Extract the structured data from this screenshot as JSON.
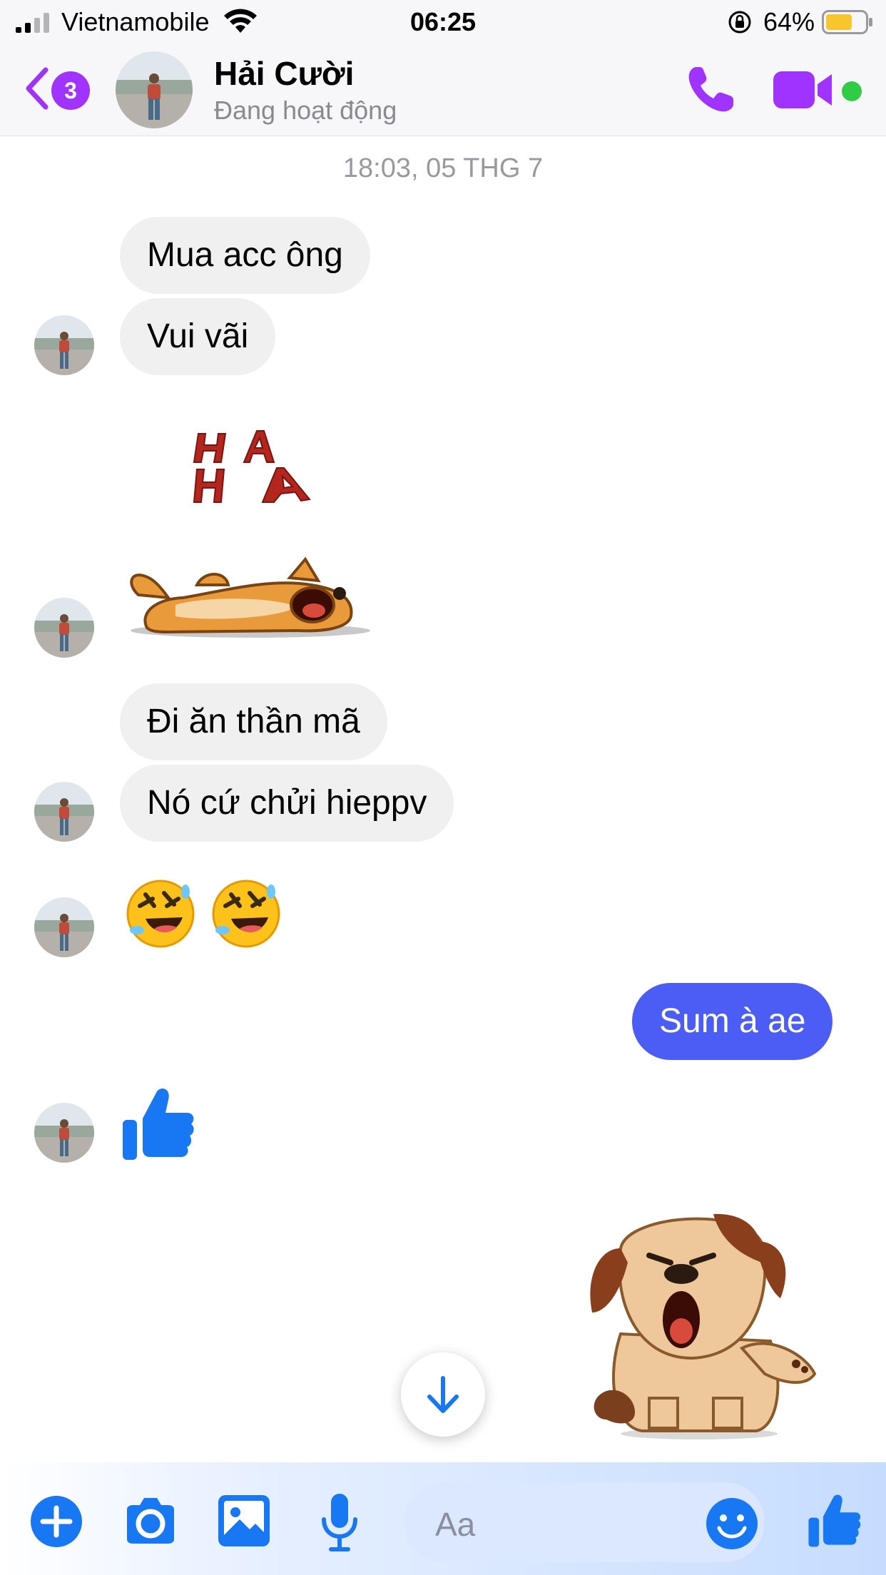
{
  "status_bar": {
    "carrier": "Vietnamobile",
    "time": "06:25",
    "battery": "64%"
  },
  "header": {
    "back_badge": "3",
    "contact_name": "Hải Cười",
    "contact_status": "Đang hoạt động"
  },
  "conversation": {
    "timestamp": "18:03, 05 THG 7",
    "messages_in": [
      "Mua acc ông",
      "Vui vãi",
      "Đi ăn thần mã",
      "Nó cứ chửi hieppv"
    ],
    "message_out": "Sum à ae"
  },
  "composer": {
    "placeholder": "Aa"
  },
  "colors": {
    "accent": "#a033ff",
    "messenger_blue": "#4b5df4",
    "bubble_gray": "#f0f0f0"
  }
}
